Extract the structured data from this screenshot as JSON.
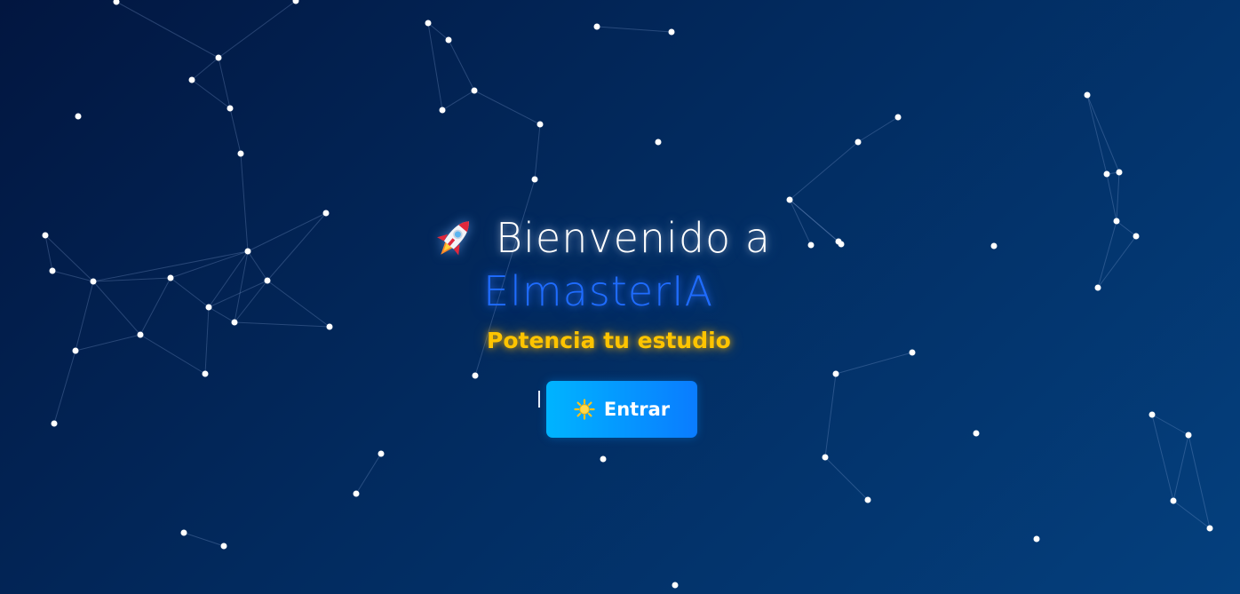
{
  "hero": {
    "greeting": "Bienvenido a",
    "brand": "ElmasterIA",
    "tagline": "Potencia tu estudio"
  },
  "actions": {
    "enter_label": "Entrar"
  },
  "icons": {
    "title_icon": "rocket-icon",
    "button_icon": "sun-icon"
  },
  "colors": {
    "background_dark": "#021640",
    "background_light": "#04407e",
    "brand_blue": "#1f6cff",
    "tagline_yellow": "#ffc400",
    "button_start": "#00b4ff",
    "button_end": "#0a7cff"
  }
}
